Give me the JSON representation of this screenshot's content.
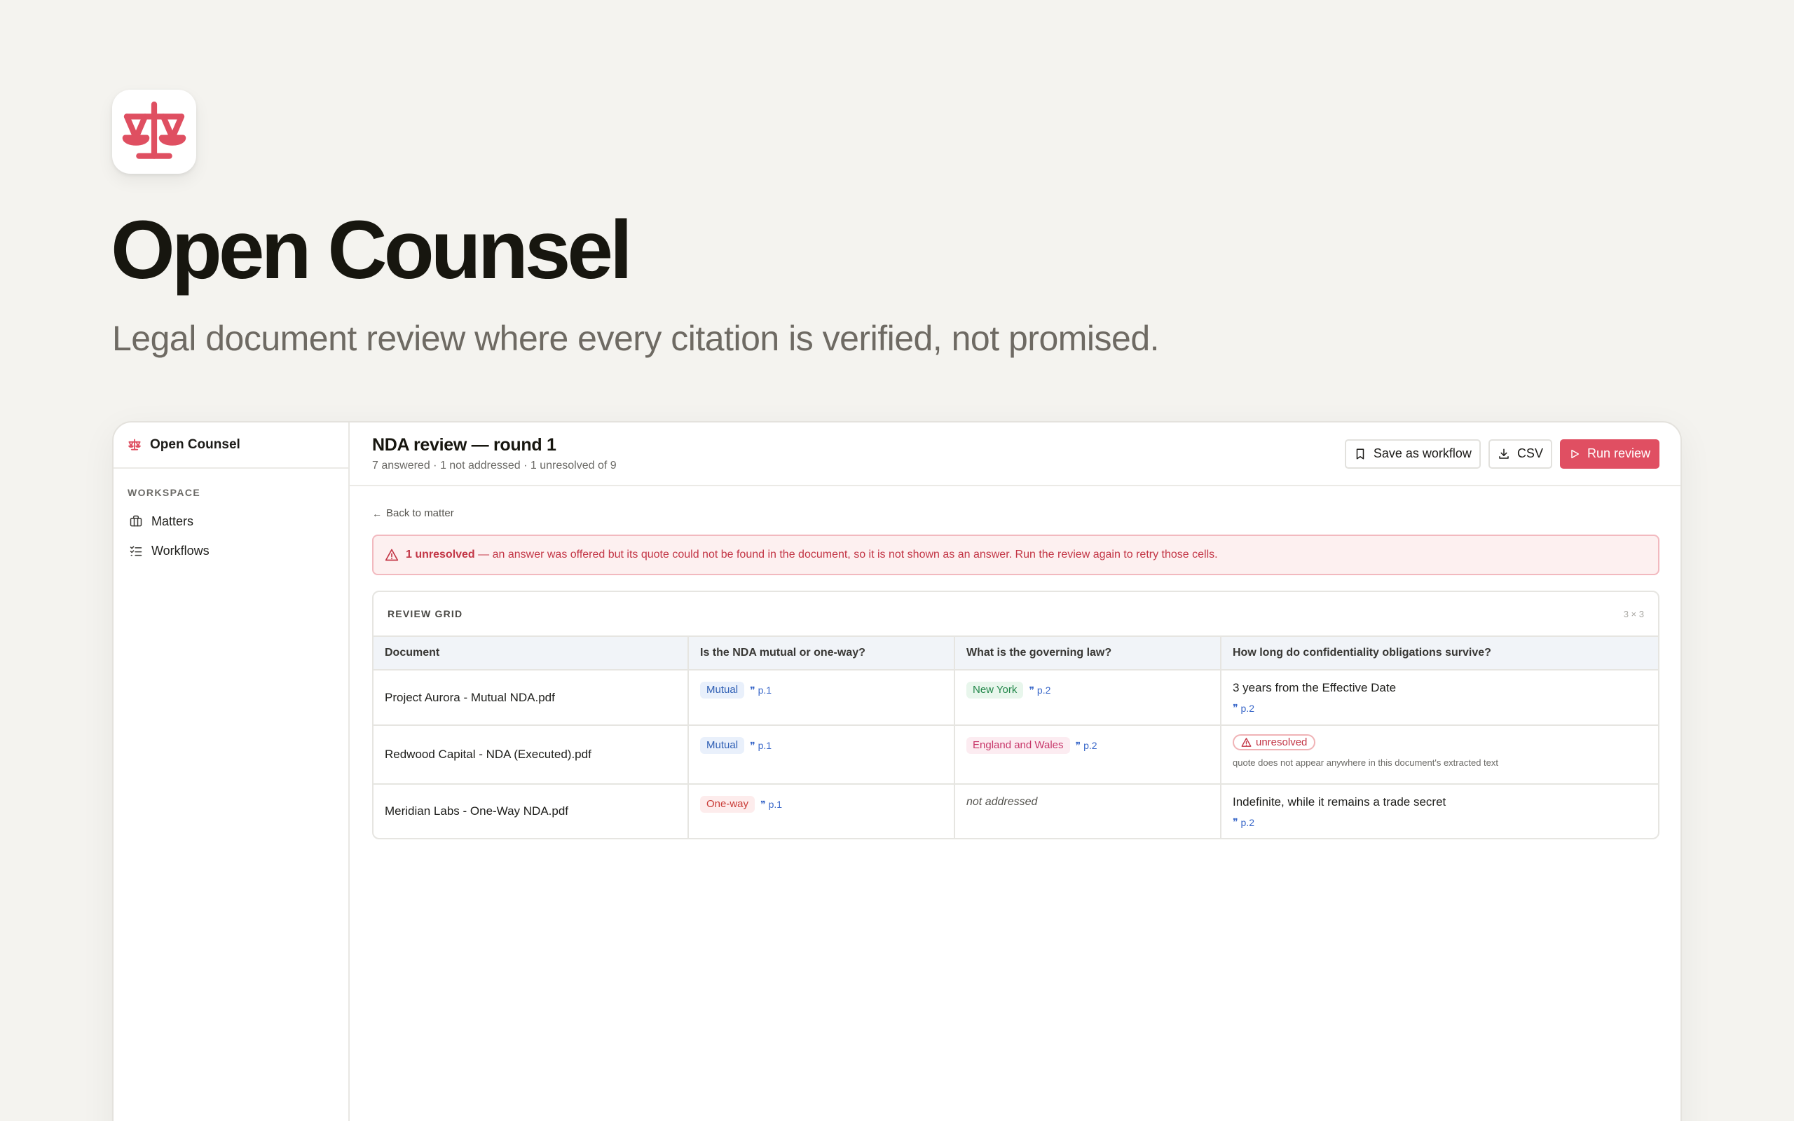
{
  "hero": {
    "title": "Open Counsel",
    "subtitle": "Legal document review where every citation is verified, not promised."
  },
  "sidebar": {
    "brand": "Open Counsel",
    "section_label": "WORKSPACE",
    "items": [
      {
        "label": "Matters",
        "icon": "briefcase-icon"
      },
      {
        "label": "Workflows",
        "icon": "checklist-icon"
      }
    ]
  },
  "header": {
    "title": "NDA review — round 1",
    "stats": "7 answered · 1 not addressed · 1 unresolved of 9",
    "save_workflow_label": "Save as workflow",
    "csv_label": "CSV",
    "run_review_label": "Run review"
  },
  "back_link": "Back to matter",
  "alert": {
    "strong": "1 unresolved",
    "text": " — an answer was offered but its quote could not be found in the document, so it is not shown as an answer. Run the review again to retry those cells."
  },
  "grid": {
    "title": "REVIEW GRID",
    "dims": "3 × 3",
    "columns": [
      "Document",
      "Is the NDA mutual or one-way?",
      "What is the governing law?",
      "How long do confidentiality obligations survive?"
    ],
    "rows": [
      {
        "document": "Project Aurora - Mutual NDA.pdf",
        "mutual": {
          "value": "Mutual",
          "cite": "p.1"
        },
        "law": {
          "value": "New York",
          "cite": "p.2"
        },
        "survive": {
          "value": "3 years from the Effective Date",
          "cite": "p.2"
        }
      },
      {
        "document": "Redwood Capital - NDA (Executed).pdf",
        "mutual": {
          "value": "Mutual",
          "cite": "p.1"
        },
        "law": {
          "value": "England and Wales",
          "cite": "p.2"
        },
        "survive": {
          "status": "unresolved",
          "note": "quote does not appear anywhere in this document's extracted text"
        }
      },
      {
        "document": "Meridian Labs - One-Way NDA.pdf",
        "mutual": {
          "value": "One-way",
          "cite": "p.1"
        },
        "law": {
          "value": "not addressed"
        },
        "survive": {
          "value": "Indefinite, while it remains a trade secret",
          "cite": "p.2"
        }
      }
    ]
  },
  "colors": {
    "accent": "#e04f62",
    "background": "#f4f3ef",
    "alert_bg": "#fdf0f0",
    "citation": "#3a68c9"
  }
}
